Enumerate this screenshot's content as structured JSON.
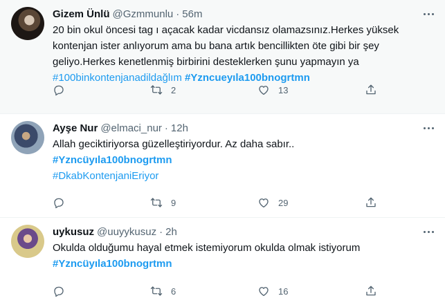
{
  "tweets": [
    {
      "name": "Gizem Ünlü",
      "handle": "@Gzmmunlu",
      "dot": "·",
      "time": "56m",
      "text_lines": [
        "20 bin okul öncesi tag ı açacak kadar vicdansız olamazsınız.Herkes yüksek",
        "kontenjan ister anlıyorum ama bu bana artık bencillikten öte gibi bir şey",
        "geliyo.Herkes kenetlenmiş birbirini desteklerken şunu yapmayın ya"
      ],
      "hashtag_a": "#100binkontenjanadildağlım",
      "hashtag_b": "#Yzncueyıla100bnogrtmn",
      "retweets": "2",
      "likes": "13"
    },
    {
      "name": "Ayşe Nur",
      "handle": "@elmaci_nur",
      "dot": "·",
      "time": "12h",
      "text_lines": [
        "Allah geciktiriyorsa güzelleştiriyordur. Az daha sabır.."
      ],
      "hashtag_a": "#Yzncüyıla100bnogrtmn",
      "hashtag_b": "#DkabKontenjaniEriyor",
      "retweets": "9",
      "likes": "29"
    },
    {
      "name": "uykusuz",
      "handle": "@uuyykusuz",
      "dot": "·",
      "time": "2h",
      "text_lines": [
        "Okulda olduğumu hayal etmek istemiyorum okulda olmak istiyorum"
      ],
      "hashtag_a": "#Yzncüyıla100bnogrtmn",
      "retweets": "6",
      "likes": "16"
    }
  ],
  "icons": [
    "reply-icon",
    "retweet-icon",
    "like-icon",
    "share-icon",
    "more-icon"
  ],
  "colors": {
    "link": "#1d9bf0",
    "secondary": "#536471",
    "hover_bg": "#f7f9f9"
  }
}
